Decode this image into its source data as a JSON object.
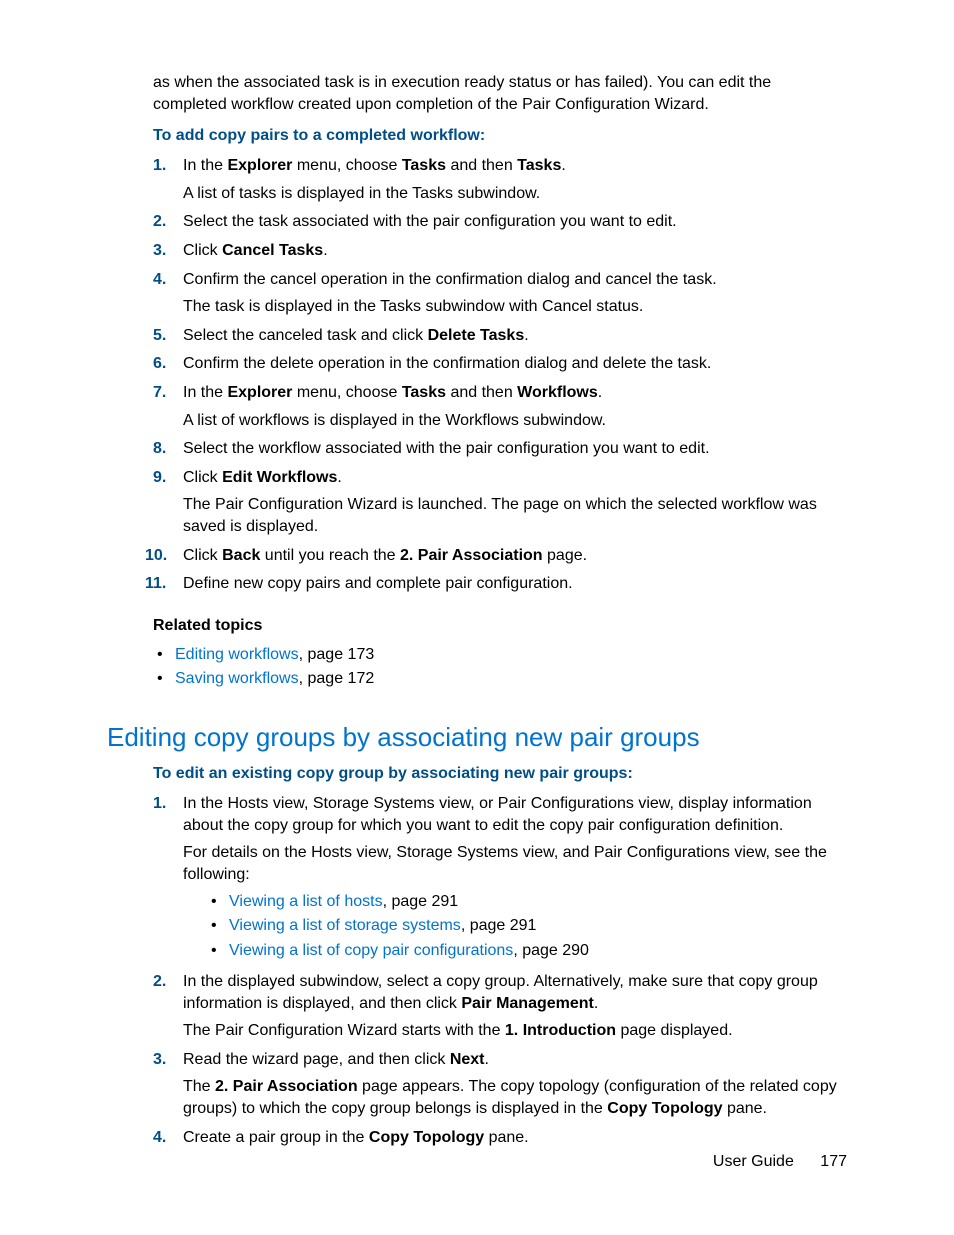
{
  "intro_paragraph": "as when the associated task is in execution ready status or has failed). You can edit the completed workflow created upon completion of the Pair Configuration Wizard.",
  "procedure1": {
    "heading": "To add copy pairs to a completed workflow:",
    "steps": [
      {
        "num": "1.",
        "parts": [
          {
            "t": "In the "
          },
          {
            "t": "Explorer",
            "b": true
          },
          {
            "t": " menu, choose "
          },
          {
            "t": "Tasks",
            "b": true
          },
          {
            "t": " and then "
          },
          {
            "t": "Tasks",
            "b": true
          },
          {
            "t": "."
          }
        ],
        "sub": "A list of tasks is displayed in the Tasks subwindow."
      },
      {
        "num": "2.",
        "parts": [
          {
            "t": "Select the task associated with the pair configuration you want to edit."
          }
        ]
      },
      {
        "num": "3.",
        "parts": [
          {
            "t": "Click "
          },
          {
            "t": "Cancel Tasks",
            "b": true
          },
          {
            "t": "."
          }
        ]
      },
      {
        "num": "4.",
        "parts": [
          {
            "t": "Confirm the cancel operation in the confirmation dialog and cancel the task."
          }
        ],
        "sub": "The task is displayed in the Tasks subwindow with Cancel status."
      },
      {
        "num": "5.",
        "parts": [
          {
            "t": "Select the canceled task and click "
          },
          {
            "t": "Delete Tasks",
            "b": true
          },
          {
            "t": "."
          }
        ]
      },
      {
        "num": "6.",
        "parts": [
          {
            "t": "Confirm the delete operation in the confirmation dialog and delete the task."
          }
        ]
      },
      {
        "num": "7.",
        "parts": [
          {
            "t": "In the "
          },
          {
            "t": "Explorer",
            "b": true
          },
          {
            "t": " menu, choose "
          },
          {
            "t": "Tasks",
            "b": true
          },
          {
            "t": " and then "
          },
          {
            "t": "Workflows",
            "b": true
          },
          {
            "t": "."
          }
        ],
        "sub": "A list of workflows is displayed in the Workflows subwindow."
      },
      {
        "num": "8.",
        "parts": [
          {
            "t": "Select the workflow associated with the pair configuration you want to edit."
          }
        ]
      },
      {
        "num": "9.",
        "parts": [
          {
            "t": "Click "
          },
          {
            "t": "Edit Workflows",
            "b": true
          },
          {
            "t": "."
          }
        ],
        "sub": "The Pair Configuration Wizard is launched. The page on which the selected workflow was saved is displayed."
      },
      {
        "num": "10.",
        "parts": [
          {
            "t": "Click "
          },
          {
            "t": "Back",
            "b": true
          },
          {
            "t": " until you reach the "
          },
          {
            "t": "2. Pair Association",
            "b": true
          },
          {
            "t": " page."
          }
        ]
      },
      {
        "num": "11.",
        "parts": [
          {
            "t": "Define new copy pairs and complete pair configuration."
          }
        ]
      }
    ]
  },
  "related": {
    "heading": "Related topics",
    "items": [
      {
        "link": "Editing workflows",
        "suffix": ", page 173"
      },
      {
        "link": "Saving workflows",
        "suffix": ", page 172"
      }
    ]
  },
  "section2": {
    "title": "Editing copy groups by associating new pair groups",
    "heading": "To edit an existing copy group by associating new pair groups:",
    "steps": [
      {
        "num": "1.",
        "parts": [
          {
            "t": "In the Hosts view, Storage Systems view, or Pair Configurations view, display information about the copy group for which you want to edit the copy pair configuration definition."
          }
        ],
        "sub": "For details on the Hosts view, Storage Systems view, and Pair Configurations view, see the following:",
        "links": [
          {
            "link": "Viewing a list of hosts",
            "suffix": ", page 291"
          },
          {
            "link": "Viewing a list of storage systems",
            "suffix": ", page 291"
          },
          {
            "link": "Viewing a list of copy pair configurations",
            "suffix": ", page 290"
          }
        ]
      },
      {
        "num": "2.",
        "parts": [
          {
            "t": "In the displayed subwindow, select a copy group. Alternatively, make sure that copy group information is displayed, and then click "
          },
          {
            "t": "Pair Management",
            "b": true
          },
          {
            "t": "."
          }
        ],
        "sub_parts": [
          {
            "t": "The Pair Configuration Wizard starts with the "
          },
          {
            "t": "1. Introduction",
            "b": true
          },
          {
            "t": " page displayed."
          }
        ]
      },
      {
        "num": "3.",
        "parts": [
          {
            "t": "Read the wizard page, and then click "
          },
          {
            "t": "Next",
            "b": true
          },
          {
            "t": "."
          }
        ],
        "sub_parts": [
          {
            "t": "The "
          },
          {
            "t": "2. Pair Association",
            "b": true
          },
          {
            "t": " page appears. The copy topology (configuration of the related copy groups) to which the copy group belongs is displayed in the "
          },
          {
            "t": "Copy Topology",
            "b": true
          },
          {
            "t": " pane."
          }
        ]
      },
      {
        "num": "4.",
        "parts": [
          {
            "t": "Create a pair group in the "
          },
          {
            "t": "Copy Topology",
            "b": true
          },
          {
            "t": " pane."
          }
        ]
      }
    ]
  },
  "footer": {
    "label": "User Guide",
    "page": "177"
  }
}
